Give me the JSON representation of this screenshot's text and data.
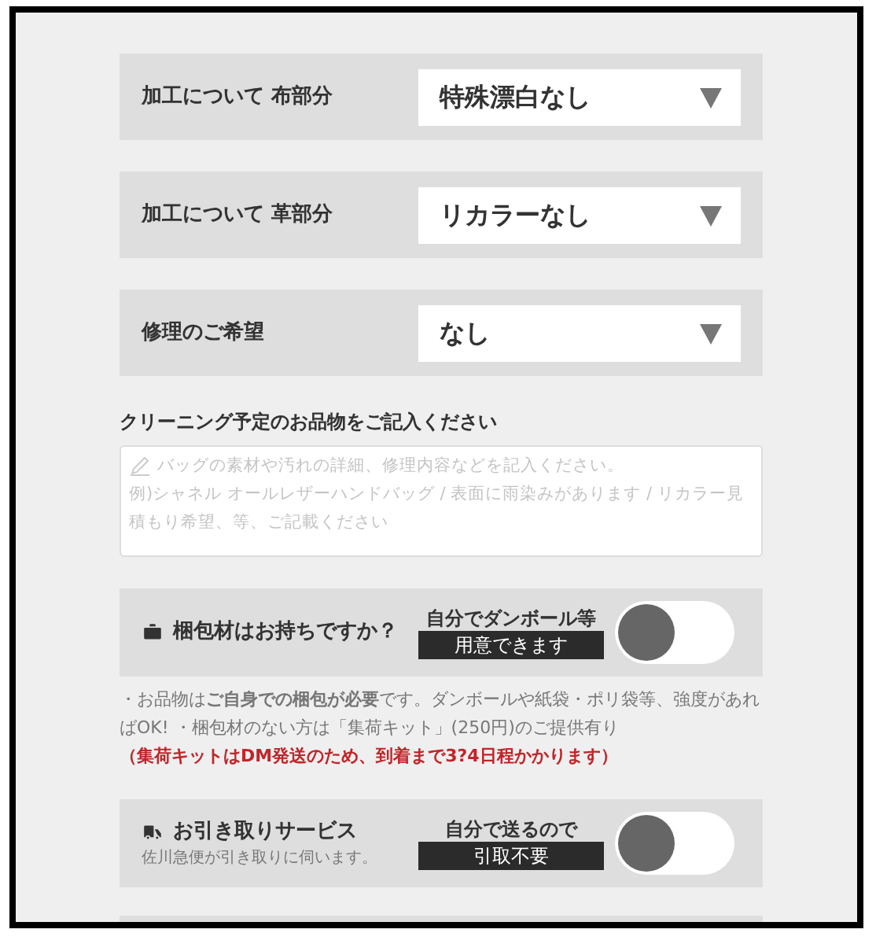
{
  "selects": [
    {
      "label": "加工について 布部分",
      "value": "特殊漂白なし"
    },
    {
      "label": "加工について 革部分",
      "value": "リカラーなし"
    },
    {
      "label": "修理のご希望",
      "value": "なし"
    }
  ],
  "items_field": {
    "label": "クリーニング予定のお品物をご記入ください",
    "hint_lines": [
      "バッグの素材や汚れの詳細、修理内容などを記入ください。",
      "例)シャネル オールレザーハンドバッグ / 表面に雨染みがあります / リカラー見積もり希望、等、ご記載ください"
    ]
  },
  "packing": {
    "kind": "briefcase",
    "label": "梱包材はお持ちですか？",
    "option_top": "自分でダンボール等",
    "option_badge": "用意できます",
    "on": false
  },
  "packing_note": {
    "text": "・お品物は**ご自身での梱包が必要**です。ダンボールや紙袋・ポリ袋等、強度があればOK! ・梱包材のない方は「集荷キット」(250円)のご提供有り",
    "warning": "（集荷キットはDM発送のため、到着まで3?4日程かかります）"
  },
  "pickup": {
    "kind": "truck",
    "label": "お引き取りサービス",
    "sublabel": "佐川急便が引き取りに伺います。",
    "option_top": "自分で送るので",
    "option_badge": "引取不要",
    "on": false
  }
}
